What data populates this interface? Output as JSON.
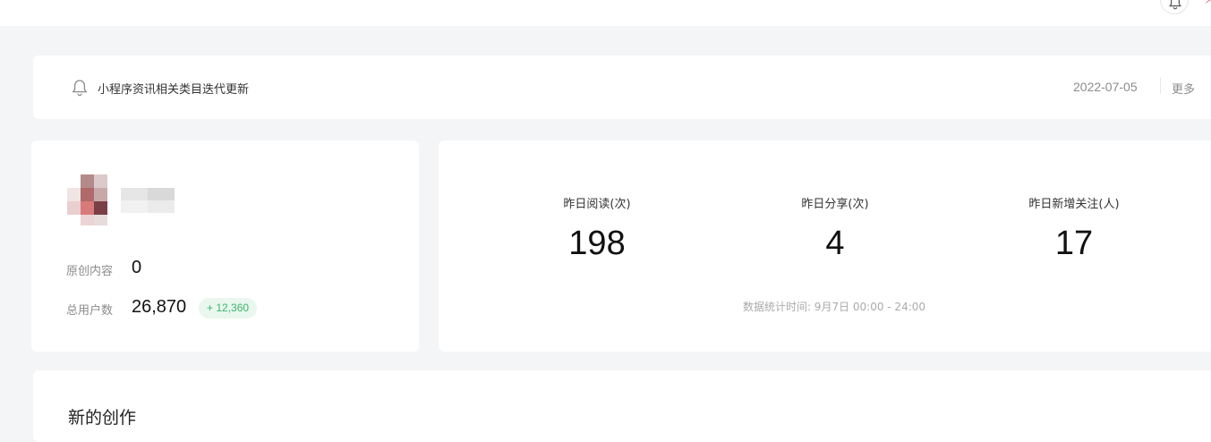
{
  "notice": {
    "title": "小程序资讯相关类目迭代更新",
    "date": "2022-07-05",
    "more_label": "更多"
  },
  "account": {
    "stats": [
      {
        "label": "原创内容",
        "value": "0"
      },
      {
        "label": "总用户数",
        "value": "26,870",
        "growth": "+ 12,360"
      }
    ]
  },
  "metrics": {
    "items": [
      {
        "label": "昨日阅读(次)",
        "value": "198"
      },
      {
        "label": "昨日分享(次)",
        "value": "4"
      },
      {
        "label": "昨日新增关注(人)",
        "value": "17"
      }
    ],
    "note": "数据统计时间: 9月7日 00:00 - 24:00"
  },
  "creation": {
    "title": "新的创作"
  },
  "colors": {
    "page_bg": "#f4f5f7",
    "card_bg": "#ffffff",
    "growth_text": "#3cb46e",
    "growth_bg": "#e9f7ef"
  },
  "icons": {
    "top": "bell-icon",
    "notice": "bell-icon"
  }
}
